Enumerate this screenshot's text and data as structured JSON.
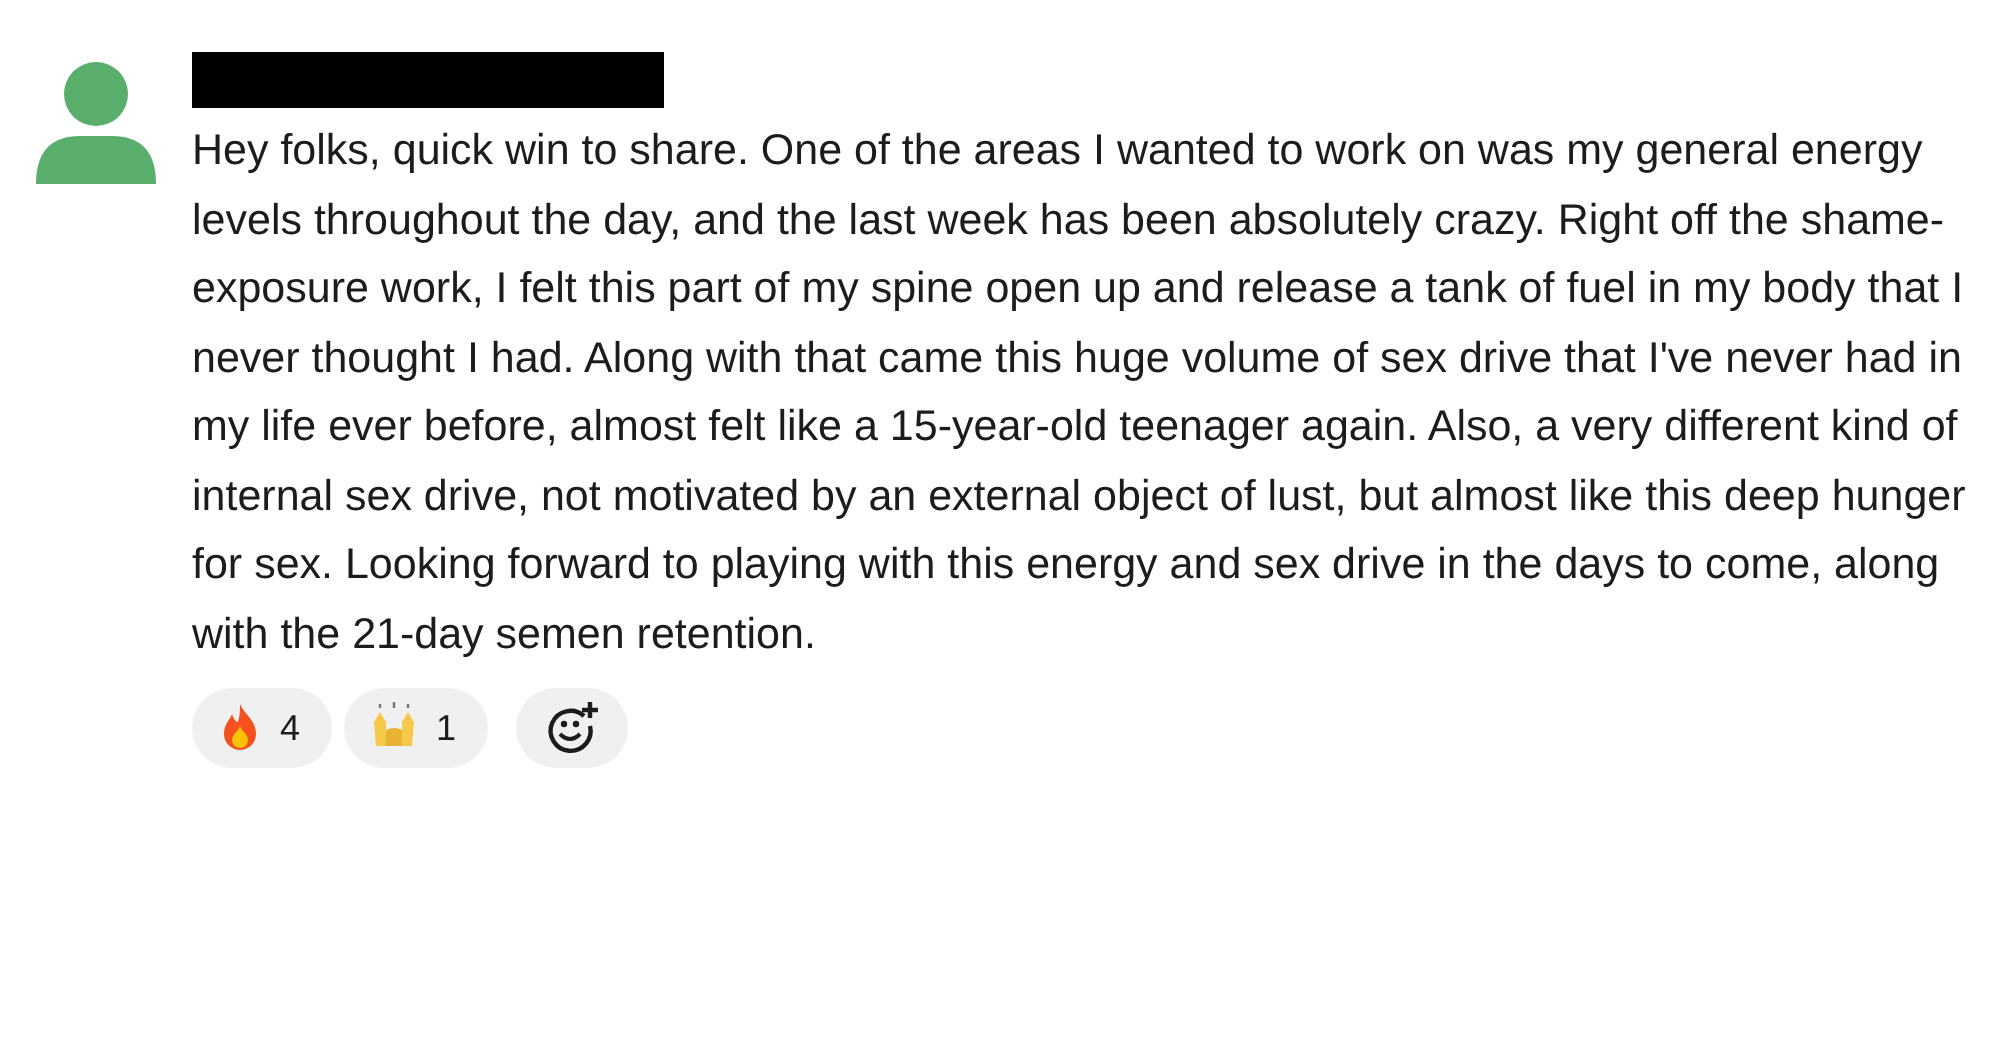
{
  "message": {
    "text": "Hey folks, quick win to share. One of the areas I wanted to work on was my general energy levels throughout the day, and the last week has been absolutely crazy. Right off the shame-exposure work, I felt this part of my spine open up and release a tank of fuel in my body that I never thought I had. Along with that came this huge volume of sex drive that I've never had in my life ever before, almost felt like a 15-year-old teenager again. Also, a very different kind of internal sex drive, not motivated by an external object of lust, but almost like this deep hunger for sex. Looking forward to playing with this energy and sex drive in the days to come, along with the 21-day semen retention.",
    "reactions": [
      {
        "kind": "fire",
        "count": "4"
      },
      {
        "kind": "raised-hands",
        "count": "1"
      }
    ]
  }
}
